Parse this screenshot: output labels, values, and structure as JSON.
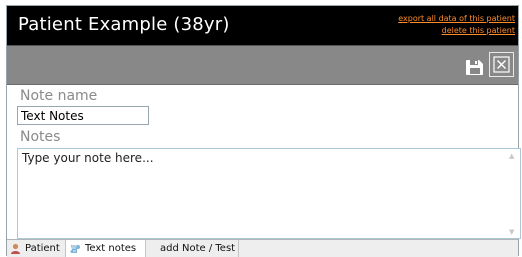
{
  "header": {
    "patient_title": "Patient Example (38yr)",
    "export_link": "export all data of this patient",
    "delete_link": "delete this patient"
  },
  "toolbar": {
    "save_icon": "save-disk-icon",
    "close_icon": "close-x-icon"
  },
  "form": {
    "note_name_label": "Note name",
    "note_name_value": "Text Notes",
    "notes_label": "Notes",
    "notes_placeholder": "Type your note here..."
  },
  "tabs": [
    {
      "label": "Patient",
      "icon": "patient-icon"
    },
    {
      "label": "Text notes",
      "icon": "text-notes-icon",
      "active": true
    },
    {
      "label": "add Note / Test"
    }
  ],
  "colors": {
    "title_bar": "#000000",
    "toolbar": "#888888",
    "link": "#ff8c28"
  }
}
